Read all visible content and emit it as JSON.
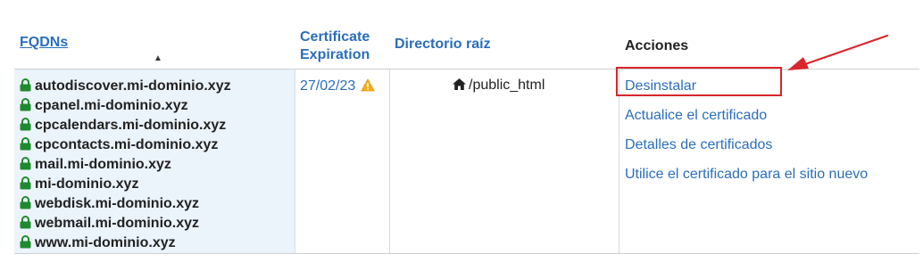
{
  "table": {
    "headers": {
      "fqdns": "FQDNs",
      "exp_line1": "Certificate",
      "exp_line2": "Expiration",
      "directory": "Directorio raíz",
      "actions": "Acciones"
    },
    "fqdns": [
      "autodiscover.mi-dominio.xyz",
      "cpanel.mi-dominio.xyz",
      "cpcalendars.mi-dominio.xyz",
      "cpcontacts.mi-dominio.xyz",
      "mail.mi-dominio.xyz",
      "mi-dominio.xyz",
      "webdisk.mi-dominio.xyz",
      "webmail.mi-dominio.xyz",
      "www.mi-dominio.xyz"
    ],
    "expiration": "27/02/23",
    "directory": "/public_html",
    "actions": [
      "Desinstalar",
      "Actualice el certificado",
      "Detalles de certificados",
      "Utilice el certificado para el sitio nuevo"
    ]
  },
  "icons": {
    "lock": "lock-icon",
    "warning": "warning-icon",
    "home": "home-icon",
    "sort": "sort-ascending-icon"
  },
  "colors": {
    "link": "#2a6ebb",
    "lock": "#1e8a2e",
    "highlight": "#d9262b",
    "fqdn_bg": "#ebf3fb"
  }
}
